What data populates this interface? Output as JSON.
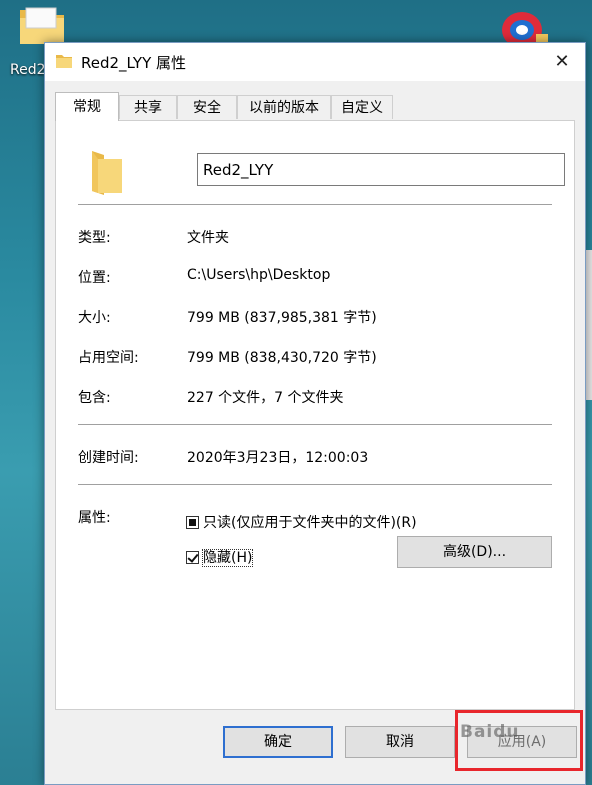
{
  "desktop": {
    "icon_label": "Red2"
  },
  "window": {
    "title": "Red2_LYY 属性"
  },
  "tabs": [
    {
      "label": "常规",
      "active": true
    },
    {
      "label": "共享",
      "active": false
    },
    {
      "label": "安全",
      "active": false
    },
    {
      "label": "以前的版本",
      "active": false
    },
    {
      "label": "自定义",
      "active": false
    }
  ],
  "general": {
    "name_value": "Red2_LYY",
    "rows": [
      {
        "label": "类型:",
        "value": "文件夹"
      },
      {
        "label": "位置:",
        "value": "C:\\Users\\hp\\Desktop"
      },
      {
        "label": "大小:",
        "value": "799 MB (837,985,381 字节)"
      },
      {
        "label": "占用空间:",
        "value": "799 MB (838,430,720 字节)"
      },
      {
        "label": "包含:",
        "value": "227 个文件，7 个文件夹"
      }
    ],
    "created": {
      "label": "创建时间:",
      "value": "2020年3月23日，12:00:03"
    },
    "attributes": {
      "label": "属性:",
      "readonly_label": "只读(仅应用于文件夹中的文件)(R)",
      "readonly_state": "indeterminate",
      "hidden_label": "隐藏(H)",
      "hidden_state": "checked",
      "advanced_label": "高级(D)..."
    }
  },
  "footer": {
    "ok_label": "确定",
    "cancel_label": "取消",
    "apply_label": "应用(A)"
  },
  "colors": {
    "highlight": "#e8262c",
    "default_button_border": "#2e6fd0",
    "folder": "#f4c95d"
  }
}
